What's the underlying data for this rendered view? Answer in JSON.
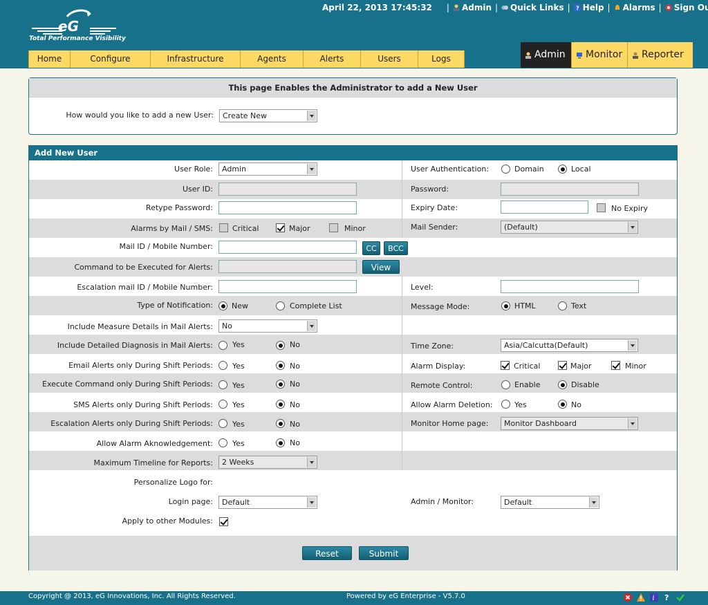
{
  "header": {
    "logo_text": "eG",
    "tagline": "Total Performance Visibility",
    "datetime": "April 22, 2013 17:45:32",
    "links": [
      "Admin",
      "Quick Links",
      "Help",
      "Alarms",
      "Sign Out"
    ],
    "nav": [
      "Home",
      "Configure",
      "Infrastructure",
      "Agents",
      "Alerts",
      "Users",
      "Logs"
    ],
    "modes": [
      "Admin",
      "Monitor",
      "Reporter"
    ]
  },
  "panel1": {
    "title": "This page Enables the Administrator to add a New User",
    "question": "How would you like to add a new User:",
    "method_value": "Create New"
  },
  "form": {
    "title": "Add New User",
    "user_role_label": "User Role:",
    "user_role_value": "Admin",
    "auth_label": "User Authentication:",
    "auth_options": [
      "Domain",
      "Local"
    ],
    "user_id_label": "User ID:",
    "password_label": "Password:",
    "retype_label": "Retype Password:",
    "expiry_label": "Expiry Date:",
    "no_expiry": "No Expiry",
    "alarms_mail_label": "Alarms by Mail / SMS:",
    "alarm_levels": [
      "Critical",
      "Major",
      "Minor"
    ],
    "mail_sender_label": "Mail Sender:",
    "mail_sender_value": "(Default)",
    "mail_id_label": "Mail ID / Mobile Number:",
    "cc": "CC",
    "bcc": "BCC",
    "command_label": "Command to be Executed for Alerts:",
    "view": "View",
    "escalation_label": "Escalation mail ID / Mobile Number:",
    "level_label": "Level:",
    "notification_label": "Type of Notification:",
    "notification_options": [
      "New",
      "Complete List"
    ],
    "message_mode_label": "Message Mode:",
    "message_mode_options": [
      "HTML",
      "Text"
    ],
    "measure_details_label": "Include Measure Details in Mail Alerts:",
    "measure_details_value": "No",
    "diagnosis_label": "Include Detailed Diagnosis in Mail Alerts:",
    "yes": "Yes",
    "no": "No",
    "timezone_label": "Time Zone:",
    "timezone_value": "Asia/Calcutta(Default)",
    "email_shift_label": "Email Alerts only During Shift Periods:",
    "alarm_display_label": "Alarm Display:",
    "exec_shift_label": "Execute Command only During Shift Periods:",
    "remote_label": "Remote Control:",
    "remote_options": [
      "Enable",
      "Disable"
    ],
    "sms_shift_label": "SMS Alerts only During Shift Periods:",
    "deletion_label": "Allow Alarm Deletion:",
    "esc_shift_label": "Escalation Alerts only During Shift Periods:",
    "monitor_home_label": "Monitor Home page:",
    "monitor_home_value": "Monitor Dashboard",
    "ack_label": "Allow Alarm Aknowledgement:",
    "timeline_label": "Maximum Timeline for Reports:",
    "timeline_value": "2 Weeks",
    "logo_label": "Personalize Logo for:",
    "login_label": "Login page:",
    "login_value": "Default",
    "admin_monitor_label": "Admin / Monitor:",
    "admin_monitor_value": "Default",
    "apply_label": "Apply to other Modules:",
    "reset": "Reset",
    "submit": "Submit"
  },
  "footer": {
    "copyright": "Copyright @ 2013, eG Innovations, Inc. All Rights Reserved.",
    "powered": "Powered by eG Enterprise - V5.7.0"
  },
  "colors": {
    "brand": "#17718a",
    "tab": "#fcd864",
    "row_alt": "#dcdcdc"
  },
  "icons": [
    "admin-icon",
    "quick-links-icon",
    "help-icon",
    "alarms-icon",
    "sign-out-icon",
    "error-icon",
    "warning-icon",
    "info-icon",
    "question-icon",
    "check-icon"
  ]
}
